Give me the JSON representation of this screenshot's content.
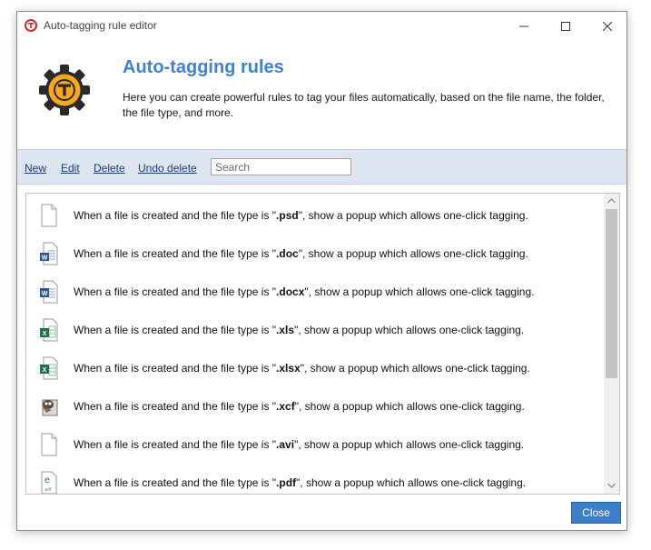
{
  "window": {
    "title": "Auto-tagging rule editor"
  },
  "header": {
    "title": "Auto-tagging rules",
    "description": "Here you can create powerful rules to tag your files automatically, based on the file name, the folder, the file type, and more."
  },
  "toolbar": {
    "new_label": "New",
    "edit_label": "Edit",
    "delete_label": "Delete",
    "undo_delete_label": "Undo delete",
    "search_placeholder": "Search"
  },
  "rules": [
    {
      "prefix": "When a file is created  and the file type is \"",
      "ext": ".psd",
      "suffix": "\", show a popup which allows one-click tagging.",
      "icon": "blank-file-icon"
    },
    {
      "prefix": "When a file is created  and the file type is \"",
      "ext": ".doc",
      "suffix": "\", show a popup which allows one-click tagging.",
      "icon": "word-doc-icon"
    },
    {
      "prefix": "When a file is created  and the file type is \"",
      "ext": ".docx",
      "suffix": "\", show a popup which allows one-click tagging.",
      "icon": "word-docx-icon"
    },
    {
      "prefix": "When a file is created  and the file type is \"",
      "ext": ".xls",
      "suffix": "\", show a popup which allows one-click tagging.",
      "icon": "excel-xls-icon"
    },
    {
      "prefix": "When a file is created  and the file type is \"",
      "ext": ".xlsx",
      "suffix": "\", show a popup which allows one-click tagging.",
      "icon": "excel-xlsx-icon"
    },
    {
      "prefix": "When a file is created  and the file type is \"",
      "ext": ".xcf",
      "suffix": "\", show a popup which allows one-click tagging.",
      "icon": "gimp-icon"
    },
    {
      "prefix": "When a file is created  and the file type is \"",
      "ext": ".avi",
      "suffix": "\", show a popup which allows one-click tagging.",
      "icon": "blank-file-icon"
    },
    {
      "prefix": "When a file is created  and the file type is \"",
      "ext": ".pdf",
      "suffix": "\", show a popup which allows one-click tagging.",
      "icon": "pdf-file-icon"
    }
  ],
  "footer": {
    "close_label": "Close"
  },
  "colors": {
    "accent": "#3f82d4",
    "toolbar_bg": "#dde5f0",
    "close_button": "#3d7fcb"
  }
}
